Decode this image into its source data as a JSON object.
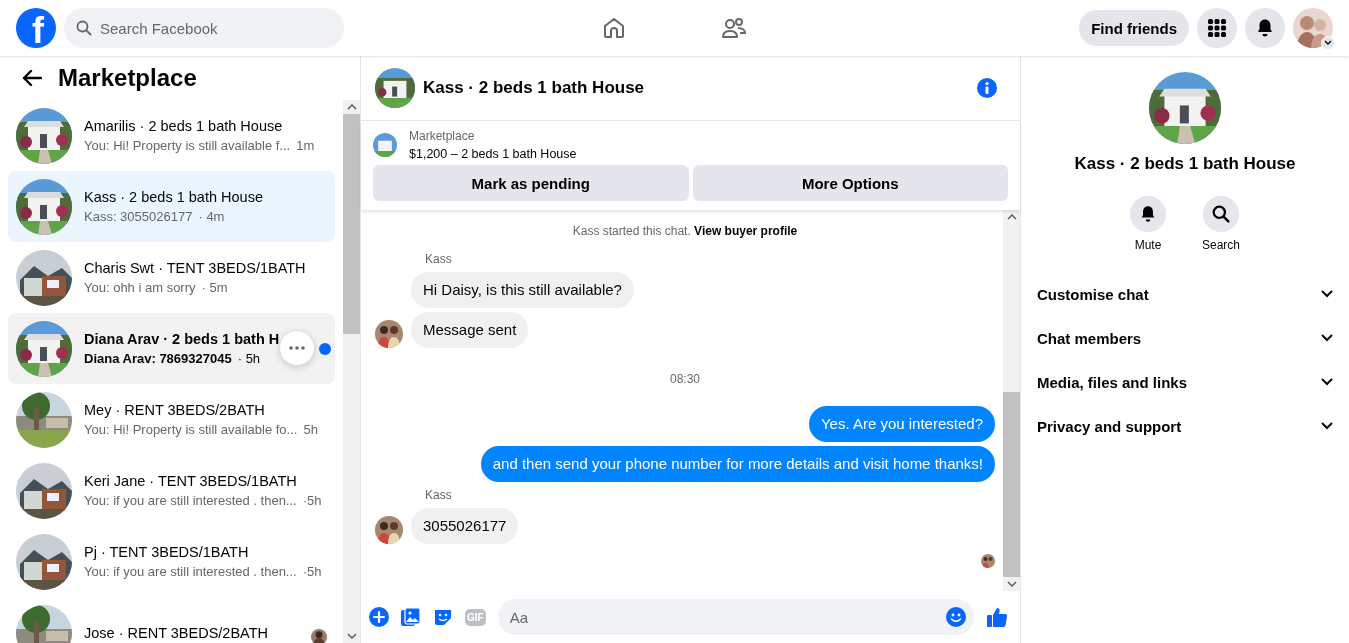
{
  "topbar": {
    "logo": "f",
    "search": {
      "placeholder": "Search Facebook"
    },
    "find_friends": "Find friends"
  },
  "sidebar": {
    "title": "Marketplace",
    "conversations": [
      {
        "title": "Amarilis · 2 beds 1 bath House",
        "preview": "You: Hi! Property is still available f...",
        "time": "1m",
        "selected": false,
        "unread": false,
        "hovered": false
      },
      {
        "title": "Kass · 2 beds 1 bath House",
        "preview": "Kass: 3055026177",
        "time": "· 4m",
        "selected": true,
        "unread": false,
        "hovered": false
      },
      {
        "title": "Charis Swt · TENT 3BEDS/1BATH",
        "preview": "You: ohh i am sorry",
        "time": "· 5m",
        "selected": false,
        "unread": false,
        "hovered": false
      },
      {
        "title": "Diana Arav · 2 beds 1 bath H",
        "preview": "Diana Arav: 7869327045",
        "time": "· 5h",
        "selected": false,
        "unread": true,
        "hovered": true
      },
      {
        "title": "Mey · RENT 3BEDS/2BATH",
        "preview": "You: Hi! Property is still available fo...",
        "time": "5h",
        "selected": false,
        "unread": false,
        "hovered": false
      },
      {
        "title": "Keri Jane · TENT 3BEDS/1BATH",
        "preview": "You: if you are still interested . then...",
        "time": "·5h",
        "selected": false,
        "unread": false,
        "hovered": false
      },
      {
        "title": "Pj · TENT 3BEDS/1BATH",
        "preview": "You: if you are still interested . then...",
        "time": "·5h",
        "selected": false,
        "unread": false,
        "hovered": false
      },
      {
        "title": "Jose · RENT 3BEDS/2BATH",
        "selected": false,
        "unread": false,
        "hovered": false
      }
    ]
  },
  "chat": {
    "title": "Kass · 2 beds 1 bath House",
    "listing": {
      "label": "Marketplace",
      "price_title": "$1,200 – 2 beds 1 bath House",
      "actions": [
        "Mark as pending",
        "More Options"
      ]
    },
    "messages": [
      {
        "kind": "notice",
        "text": "Kass started this chat.",
        "link": "View buyer profile"
      },
      {
        "kind": "incoming",
        "sender": "Kass",
        "bubbles": [
          "Hi Daisy, is this still available?",
          "Message sent"
        ]
      },
      {
        "kind": "time",
        "text": "08:30"
      },
      {
        "kind": "outgoing",
        "bubbles": [
          "Yes. Are you interested?",
          "and then send your phone number for more details and visit home thanks!"
        ]
      },
      {
        "kind": "incoming",
        "sender": "Kass",
        "bubbles": [
          "3055026177"
        ]
      }
    ],
    "composer": {
      "gif": "GIF",
      "placeholder": "Aa"
    }
  },
  "details": {
    "title": "Kass · 2 beds 1 bath House",
    "actions": [
      {
        "kind": "mute",
        "label": "Mute"
      },
      {
        "kind": "search",
        "label": "Search"
      }
    ],
    "sections": [
      "Customise chat",
      "Chat members",
      "Media, files and links",
      "Privacy and support"
    ]
  }
}
